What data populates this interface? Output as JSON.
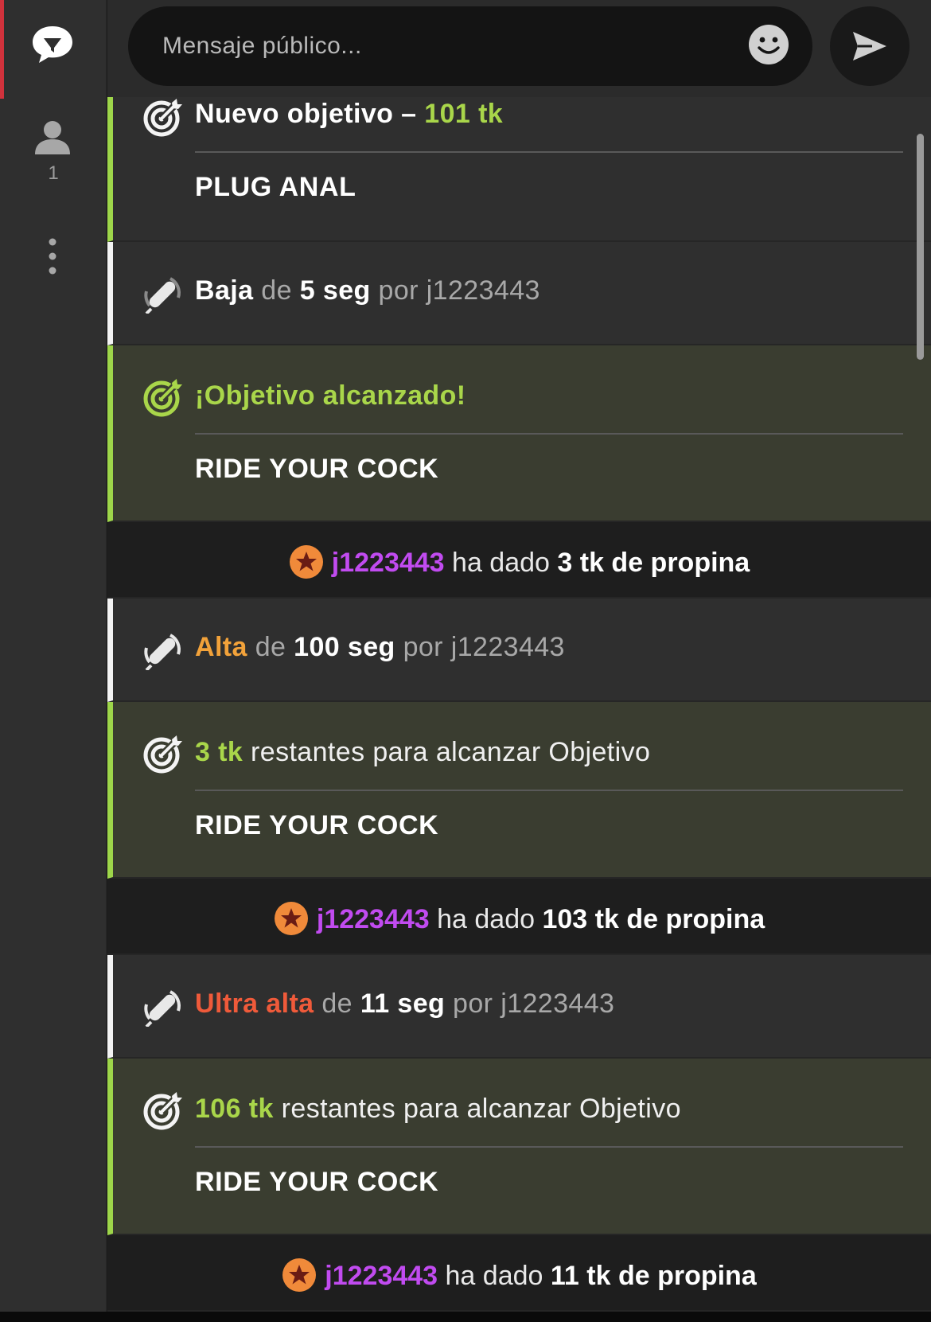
{
  "rail": {
    "chat_icon": "chat-bubble-icon",
    "user_icon": "user-icon",
    "user_count": "1",
    "more_icon": "more-vertical-icon",
    "active_color": "#d0323c"
  },
  "composer": {
    "placeholder": "Mensaje público...",
    "emoji_icon": "emoji-icon",
    "send_icon": "send-icon"
  },
  "colors": {
    "goal_green": "#a9d64a",
    "tip_purple": "#c14bf0",
    "alta_orange": "#f2a23a",
    "ultra_red": "#ef5a3a"
  },
  "feed": {
    "new_goal": {
      "prefix": "Nuevo objetivo – ",
      "amount": "101 tk",
      "label": "PLUG ANAL"
    },
    "vib1": {
      "level": "Baja",
      "de": " de ",
      "duration": "5 seg",
      "por": " por j1223443"
    },
    "goal_reached": {
      "title": "¡Objetivo alcanzado!",
      "label": "RIDE YOUR COCK"
    },
    "tip1": {
      "user": "j1223443",
      "mid": " ha dado ",
      "amount": "3 tk de propina"
    },
    "vib2": {
      "level": "Alta",
      "de": " de ",
      "duration": "100 seg",
      "por": " por j1223443"
    },
    "goal_remaining1": {
      "amount": "3 tk",
      "rest": " restantes para alcanzar Objetivo",
      "label": "RIDE YOUR COCK"
    },
    "tip2": {
      "user": "j1223443",
      "mid": " ha dado ",
      "amount": "103 tk de propina"
    },
    "vib3": {
      "level": "Ultra alta",
      "de": " de ",
      "duration": "11 seg",
      "por": " por j1223443"
    },
    "goal_remaining2": {
      "amount": "106 tk",
      "rest": " restantes para alcanzar Objetivo",
      "label": "RIDE YOUR COCK"
    },
    "tip3": {
      "user": "j1223443",
      "mid": " ha dado ",
      "amount": "11 tk de propina"
    }
  }
}
